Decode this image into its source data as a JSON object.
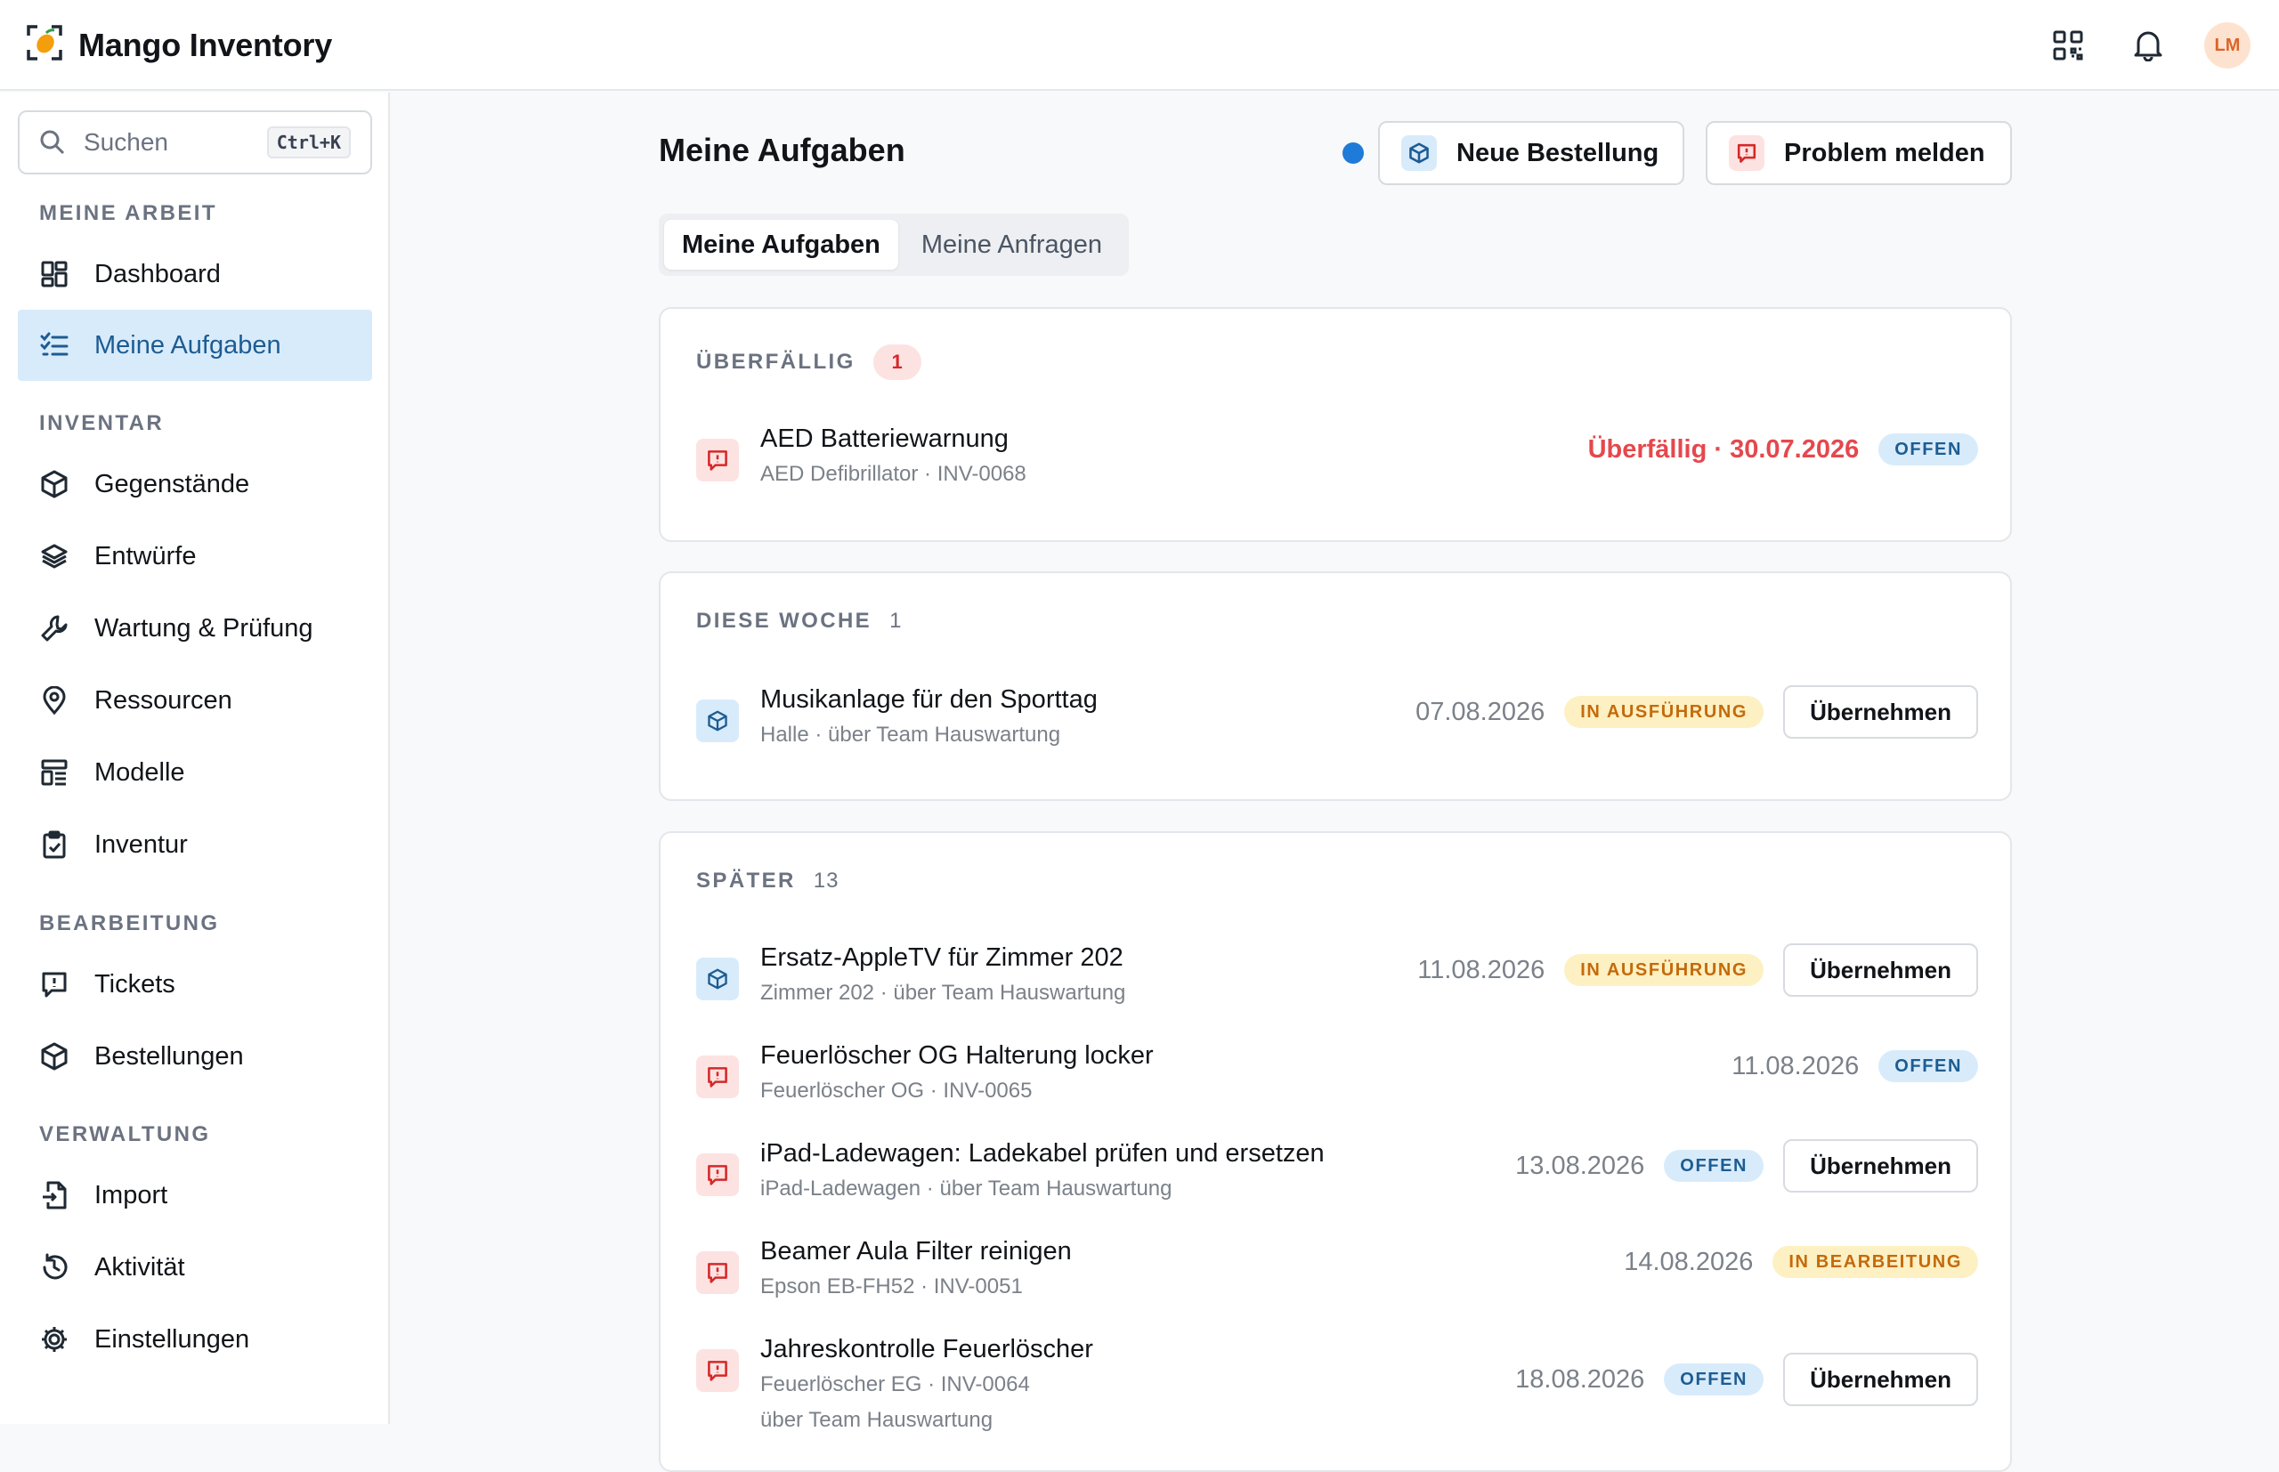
{
  "app": {
    "title": "Mango Inventory",
    "avatar": "LM"
  },
  "search": {
    "placeholder": "Suchen",
    "shortcut": "Ctrl+K"
  },
  "sidebar": {
    "sections": [
      {
        "title": "MEINE ARBEIT",
        "items": [
          {
            "label": "Dashboard",
            "icon": "dashboard-icon"
          },
          {
            "label": "Meine Aufgaben",
            "icon": "task-list-icon",
            "active": true
          }
        ]
      },
      {
        "title": "INVENTAR",
        "items": [
          {
            "label": "Gegenstände",
            "icon": "box-icon"
          },
          {
            "label": "Entwürfe",
            "icon": "layers-icon"
          },
          {
            "label": "Wartung & Prüfung",
            "icon": "wrench-icon"
          },
          {
            "label": "Ressourcen",
            "icon": "location-pin-icon"
          },
          {
            "label": "Modelle",
            "icon": "model-icon"
          },
          {
            "label": "Inventur",
            "icon": "clipboard-check-icon"
          }
        ]
      },
      {
        "title": "BEARBEITUNG",
        "items": [
          {
            "label": "Tickets",
            "icon": "ticket-icon"
          },
          {
            "label": "Bestellungen",
            "icon": "box-icon"
          }
        ]
      },
      {
        "title": "VERWALTUNG",
        "items": [
          {
            "label": "Import",
            "icon": "import-icon"
          },
          {
            "label": "Aktivität",
            "icon": "history-icon"
          },
          {
            "label": "Einstellungen",
            "icon": "gear-icon"
          }
        ]
      }
    ]
  },
  "main": {
    "title": "Meine Aufgaben",
    "actions": {
      "new_order": "Neue Bestellung",
      "report_problem": "Problem melden"
    },
    "tabs": [
      {
        "label": "Meine Aufgaben",
        "active": true
      },
      {
        "label": "Meine Anfragen",
        "active": false
      }
    ],
    "groups": [
      {
        "title": "ÜBERFÄLLIG",
        "count": "1",
        "tasks": [
          {
            "title": "AED Batteriewarnung",
            "sub": "AED Defibrillator · INV-0068",
            "kind": "ticket",
            "due": "Überfällig · 30.07.2026",
            "overdue": true,
            "status": "OFFEN",
            "status_kind": "open",
            "take": ""
          }
        ]
      },
      {
        "title": "DIESE WOCHE",
        "count": "1",
        "tasks": [
          {
            "title": "Musikanlage für den Sporttag",
            "sub": "Halle · über Team Hauswartung",
            "kind": "order",
            "due": "07.08.2026",
            "status": "IN AUSFÜHRUNG",
            "status_kind": "progress",
            "take": "Übernehmen"
          }
        ]
      },
      {
        "title": "SPÄTER",
        "count": "13",
        "tasks": [
          {
            "title": "Ersatz-AppleTV für Zimmer 202",
            "sub": "Zimmer 202 · über Team Hauswartung",
            "kind": "order",
            "due": "11.08.2026",
            "status": "IN AUSFÜHRUNG",
            "status_kind": "progress",
            "take": "Übernehmen"
          },
          {
            "title": "Feuerlöscher OG Halterung locker",
            "sub": "Feuerlöscher OG · INV-0065",
            "kind": "ticket",
            "due": "11.08.2026",
            "status": "OFFEN",
            "status_kind": "open",
            "take": ""
          },
          {
            "title": "iPad-Ladewagen: Ladekabel prüfen und ersetzen",
            "sub": "iPad-Ladewagen · über Team Hauswartung",
            "kind": "ticket",
            "due": "13.08.2026",
            "status": "OFFEN",
            "status_kind": "open",
            "take": "Übernehmen"
          },
          {
            "title": "Beamer Aula Filter reinigen",
            "sub": "Epson EB-FH52 · INV-0051",
            "kind": "ticket",
            "due": "14.08.2026",
            "status": "IN BEARBEITUNG",
            "status_kind": "progress",
            "take": ""
          },
          {
            "title": "Jahreskontrolle Feuerlöscher",
            "sub": "Feuerlöscher EG · INV-0064",
            "sub2": "über Team Hauswartung",
            "kind": "ticket",
            "due": "18.08.2026",
            "status": "OFFEN",
            "status_kind": "open",
            "take": "Übernehmen"
          }
        ]
      }
    ]
  },
  "colors": {
    "accent": "#1e7bd8",
    "active_bg": "#d8ebfb",
    "overdue": "#e5484d",
    "progress": "#c46a0b"
  }
}
